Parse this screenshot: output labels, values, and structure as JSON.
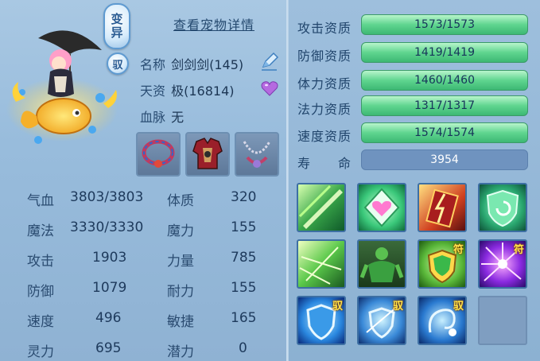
{
  "buttons": {
    "bianyi_1": "变",
    "bianyi_2": "异",
    "yu": "驭"
  },
  "detail_link": "查看宠物详情",
  "info": {
    "name_label": "名称",
    "name_value": "剑剑剑(145)",
    "talent_label": "天资",
    "talent_value": "极(16814)",
    "blood_label": "血脉",
    "blood_value": "无"
  },
  "stats": [
    {
      "label": "气血",
      "value": "3803/3803",
      "label2": "体质",
      "value2": "320"
    },
    {
      "label": "魔法",
      "value": "3330/3330",
      "label2": "魔力",
      "value2": "155"
    },
    {
      "label": "攻击",
      "value": "1903",
      "label2": "力量",
      "value2": "785"
    },
    {
      "label": "防御",
      "value": "1079",
      "label2": "耐力",
      "value2": "155"
    },
    {
      "label": "速度",
      "value": "496",
      "label2": "敏捷",
      "value2": "165"
    },
    {
      "label": "灵力",
      "value": "695",
      "label2": "潜力",
      "value2": "0"
    }
  ],
  "aptitudes": [
    {
      "label": "攻击资质",
      "value": "1573/1573"
    },
    {
      "label": "防御资质",
      "value": "1419/1419"
    },
    {
      "label": "体力资质",
      "value": "1460/1460"
    },
    {
      "label": "法力资质",
      "value": "1317/1317"
    },
    {
      "label": "速度资质",
      "value": "1574/1574"
    }
  ],
  "life": {
    "label": "寿　　命",
    "value": "3954"
  },
  "skills": [
    {
      "icon": "green-slash-icon",
      "badge": ""
    },
    {
      "icon": "heart-shield-icon",
      "badge": ""
    },
    {
      "icon": "red-lightning-card-icon",
      "badge": ""
    },
    {
      "icon": "green-recycle-shield-icon",
      "badge": ""
    },
    {
      "icon": "green-burst-icon",
      "badge": ""
    },
    {
      "icon": "green-giant-icon",
      "badge": ""
    },
    {
      "icon": "green-shield-talisman-icon",
      "badge": "符"
    },
    {
      "icon": "purple-burst-icon",
      "badge": "符"
    },
    {
      "icon": "blue-shield-icon",
      "badge": "驭"
    },
    {
      "icon": "blue-slash-shield-icon",
      "badge": "驭"
    },
    {
      "icon": "blue-swirl-icon",
      "badge": "驭"
    },
    {
      "icon": "empty-slot",
      "badge": ""
    }
  ]
}
